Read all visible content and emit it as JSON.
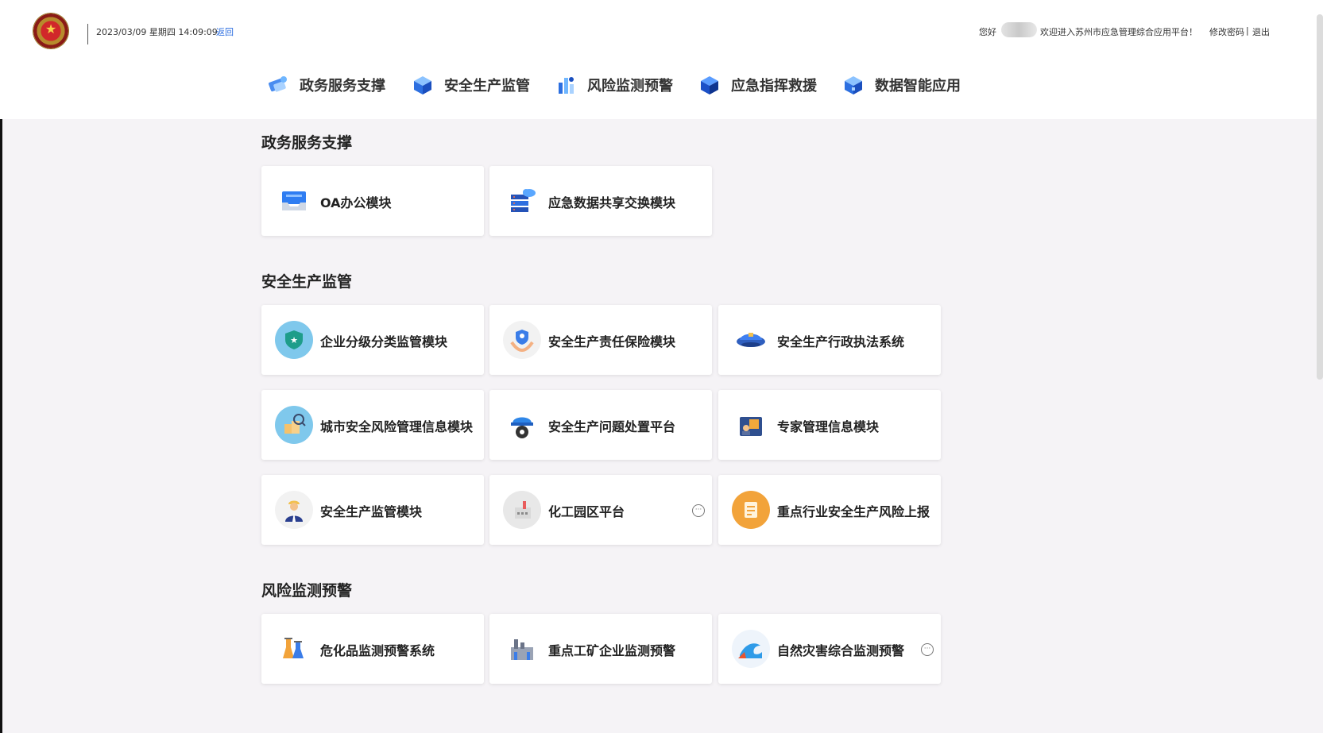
{
  "header": {
    "datetime": "2023/03/09 星期四 14:09:09",
    "back_label": "返回",
    "greeting": "您好",
    "welcome": "欢迎进入苏州市应急管理综合应用平台！",
    "change_password": "修改密码",
    "separator": "|",
    "logout": "退出"
  },
  "nav": [
    {
      "label": "政务服务支撑",
      "icon": "gov-service-icon"
    },
    {
      "label": "安全生产监管",
      "icon": "safety-cube-icon"
    },
    {
      "label": "风险监测预警",
      "icon": "risk-monitor-icon"
    },
    {
      "label": "应急指挥救援",
      "icon": "emergency-cube-icon"
    },
    {
      "label": "数据智能应用",
      "icon": "data-cube-icon"
    }
  ],
  "sections": [
    {
      "title": "政务服务支撑",
      "cards": [
        {
          "label": "OA办公模块",
          "icon": "inbox-tray-icon"
        },
        {
          "label": "应急数据共享交换模块",
          "icon": "server-cloud-icon"
        }
      ]
    },
    {
      "title": "安全生产监管",
      "cards": [
        {
          "label": "企业分级分类监管模块",
          "icon": "shield-star-icon"
        },
        {
          "label": "安全生产责任保险模块",
          "icon": "hand-shield-icon"
        },
        {
          "label": "安全生产行政执法系统",
          "icon": "police-cap-icon"
        },
        {
          "label": "城市安全风险管理信息模块",
          "icon": "city-magnifier-icon"
        },
        {
          "label": "安全生产问题处置平台",
          "icon": "helmet-gear-icon"
        },
        {
          "label": "专家管理信息模块",
          "icon": "expert-board-icon"
        },
        {
          "label": "安全生产监管模块",
          "icon": "inspector-person-icon"
        },
        {
          "label": "化工园区平台",
          "icon": "chemical-plant-icon",
          "more": "···"
        },
        {
          "label": "重点行业安全生产风险上报",
          "icon": "report-document-icon"
        }
      ]
    },
    {
      "title": "风险监测预警",
      "cards": [
        {
          "label": "危化品监测预警系统",
          "icon": "chemical-flask-icon"
        },
        {
          "label": "重点工矿企业监测预警",
          "icon": "factory-icon"
        },
        {
          "label": "自然灾害综合监测预警",
          "icon": "wave-disaster-icon",
          "more": "···"
        }
      ]
    }
  ],
  "colors": {
    "accent_blue": "#2b6de0",
    "page_bg": "#f5f3f6",
    "card_bg": "#ffffff"
  }
}
